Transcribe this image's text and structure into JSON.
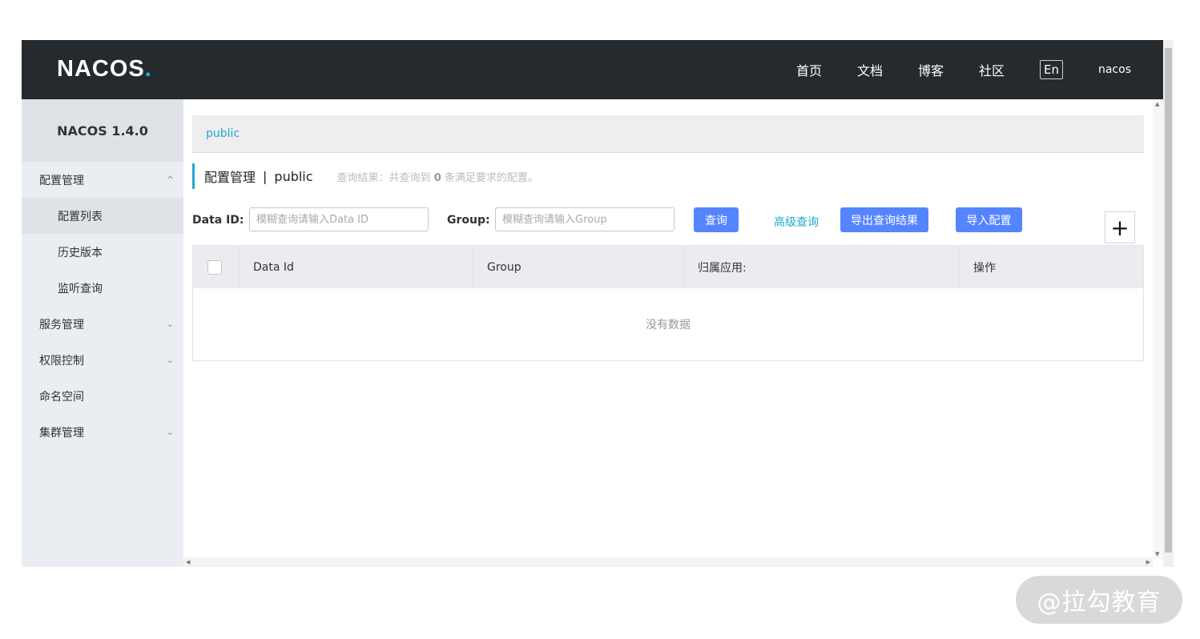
{
  "header": {
    "logo": "NACOS",
    "logo_dot": ".",
    "nav": [
      "首页",
      "文档",
      "博客",
      "社区"
    ],
    "lang": "En",
    "user": "nacos"
  },
  "sidebar": {
    "version": "NACOS 1.4.0",
    "items": [
      {
        "label": "配置管理",
        "chevron": "^"
      },
      {
        "label": "配置列表"
      },
      {
        "label": "历史版本"
      },
      {
        "label": "监听查询"
      },
      {
        "label": "服务管理",
        "chevron": "⌄"
      },
      {
        "label": "权限控制",
        "chevron": "⌄"
      },
      {
        "label": "命名空间"
      },
      {
        "label": "集群管理",
        "chevron": "⌄"
      }
    ]
  },
  "main": {
    "breadcrumb": "public",
    "title": "配置管理",
    "separator": "|",
    "namespace": "public",
    "result_prefix": "查询结果：共查询到",
    "result_count": "0",
    "result_suffix": "条满足要求的配置。",
    "filter": {
      "data_id_label": "Data ID:",
      "data_id_placeholder": "模糊查询请输入Data ID",
      "group_label": "Group:",
      "group_placeholder": "模糊查询请输入Group",
      "query_button": "查询",
      "advanced_link": "高级查询",
      "export_button": "导出查询结果",
      "import_button": "导入配置",
      "add_symbol": "+"
    },
    "table": {
      "columns": [
        "Data Id",
        "Group",
        "归属应用:",
        "操作"
      ],
      "empty_text": "没有数据"
    }
  },
  "watermark": "@拉勾教育",
  "colors": {
    "topbar": "#252a2f",
    "accent": "#21a9cc",
    "primary_button": "#5584ff"
  }
}
